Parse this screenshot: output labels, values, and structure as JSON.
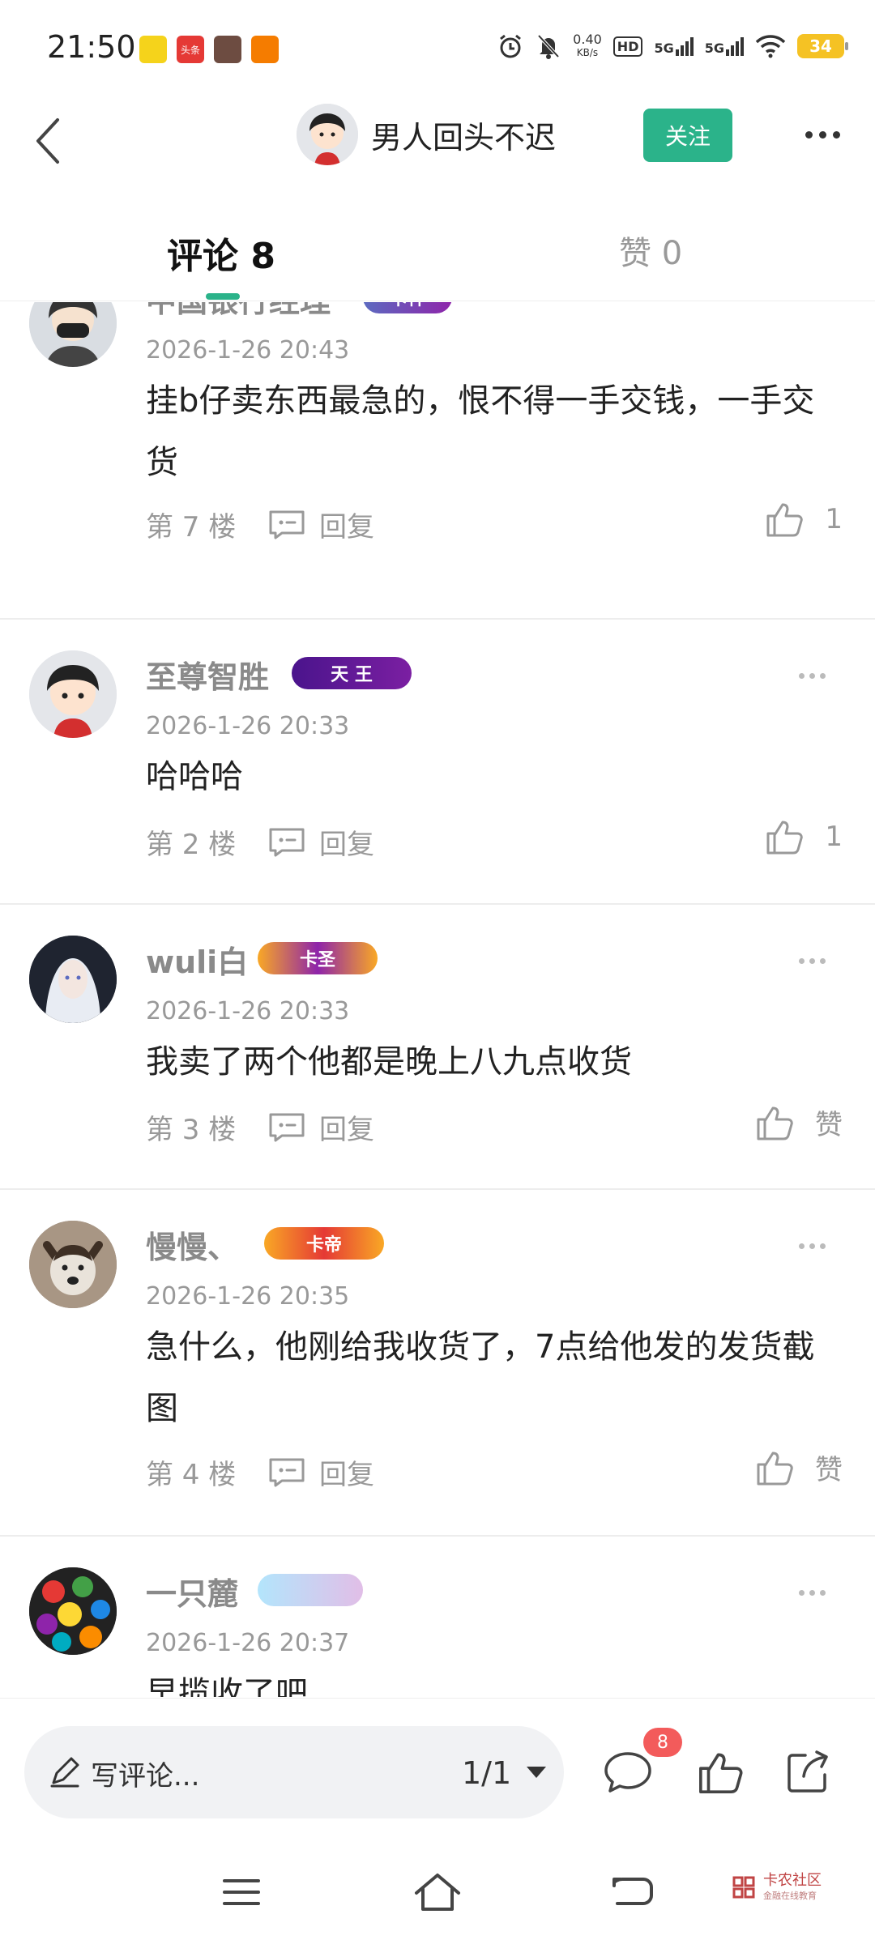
{
  "status_bar": {
    "time": "21:50",
    "net_speed_value": "0.40",
    "net_speed_unit": "KB/s",
    "hd_label": "HD",
    "sim1_label": "5G",
    "sim2_label": "5G",
    "battery": "34",
    "notification_apps": [
      "app-1",
      "头条",
      "app-3",
      "app-4"
    ]
  },
  "header": {
    "author_name": "男人回头不迟",
    "follow_label": "关注"
  },
  "tabs": {
    "comments_label": "评论 8",
    "likes_label": "赞 0"
  },
  "comments": [
    {
      "name": "中国银行经理",
      "badge": "卡神",
      "time": "2026-1-26 20:43",
      "text": "挂b仔卖东西最急的，恨不得一手交钱，一手交货",
      "floor": "第 7 楼",
      "reply_label": "回复",
      "likes": "1"
    },
    {
      "name": "至尊智胜",
      "badge": "天 王",
      "time": "2026-1-26 20:33",
      "text": "哈哈哈",
      "floor": "第 2 楼",
      "reply_label": "回复",
      "likes": "1"
    },
    {
      "name": "wuli白",
      "badge": "卡圣",
      "time": "2026-1-26 20:33",
      "text": "我卖了两个他都是晚上八九点收货",
      "floor": "第 3 楼",
      "reply_label": "回复",
      "likes": "赞"
    },
    {
      "name": "慢慢、",
      "badge": "卡帝",
      "time": "2026-1-26 20:35",
      "text": "急什么，他刚给我收货了，7点给他发的发货截图",
      "floor": "第 4 楼",
      "reply_label": "回复",
      "likes": "赞"
    },
    {
      "name": "一只麓",
      "badge": "",
      "time": "2026-1-26 20:37",
      "text": "早揽收了吧",
      "floor": "",
      "reply_label": "",
      "likes": ""
    }
  ],
  "bottom_bar": {
    "write_placeholder": "写评论...",
    "page_indicator": "1/1",
    "comment_count": "8"
  },
  "watermark": {
    "title": "卡农社区",
    "subtitle": "金融在线教育"
  },
  "colors": {
    "accent": "#2bb38a",
    "badge_red": "#f35b5b"
  }
}
